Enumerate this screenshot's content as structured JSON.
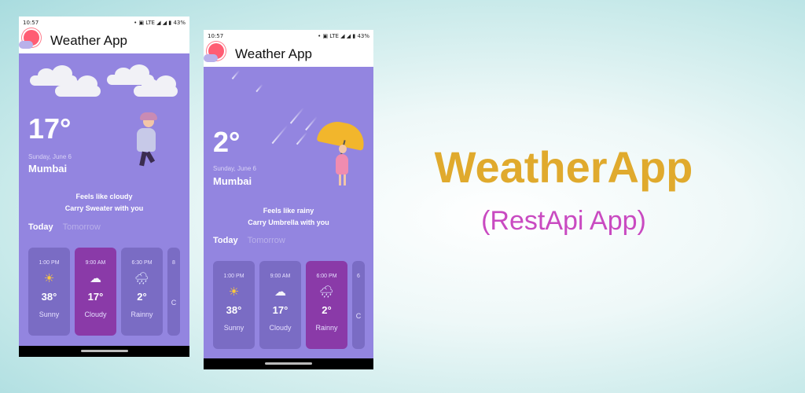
{
  "banner": {
    "title": "WeatherApp",
    "subtitle": "(RestApi App)"
  },
  "colors": {
    "title": "#e0aa2d",
    "subtitle": "#c94ac1",
    "phone_bg": "#9385e0",
    "card_bg": "#7a6cc4",
    "card_active": "#8a3aa8"
  },
  "phones": [
    {
      "status_time": "10:57",
      "status_icons": "• ▣ LTE ◢ ◢ ▮ 43%",
      "app_title": "Weather App",
      "temperature": "17°",
      "date": "Sunday, June 6",
      "city": "Mumbai",
      "feels_like": "Feels like cloudy",
      "advice": "Carry Sweater with you",
      "tabs": [
        "Today",
        "Tomorrow"
      ],
      "forecast": [
        {
          "time": "1:00 PM",
          "icon": "sun-icon",
          "glyph": "☀",
          "temp": "38°",
          "condition": "Sunny"
        },
        {
          "time": "9:00 AM",
          "icon": "cloud-icon",
          "glyph": "☁",
          "temp": "17°",
          "condition": "Cloudy"
        },
        {
          "time": "6:30 PM",
          "icon": "rain-cloud-icon",
          "glyph": "🌧",
          "temp": "2°",
          "condition": "Rainny"
        },
        {
          "time": "8",
          "icon": "",
          "glyph": "",
          "temp": "",
          "condition": "C"
        }
      ],
      "active_card": 1
    },
    {
      "status_time": "10:57",
      "status_icons": "• ▣ LTE ◢ ◢ ▮ 43%",
      "app_title": "Weather App",
      "temperature": "2°",
      "date": "Sunday, June 6",
      "city": "Mumbai",
      "feels_like": "Feels like rainy",
      "advice": "Carry Umbrella with you",
      "tabs": [
        "Today",
        "Tomorrow"
      ],
      "forecast": [
        {
          "time": "1:00 PM",
          "icon": "sun-icon",
          "glyph": "☀",
          "temp": "38°",
          "condition": "Sunny"
        },
        {
          "time": "9:00 AM",
          "icon": "cloud-icon",
          "glyph": "☁",
          "temp": "17°",
          "condition": "Cloudy"
        },
        {
          "time": "6:00 PM",
          "icon": "rain-cloud-icon",
          "glyph": "🌧",
          "temp": "2°",
          "condition": "Rainny"
        },
        {
          "time": "6",
          "icon": "",
          "glyph": "",
          "temp": "",
          "condition": "C"
        }
      ],
      "active_card": 2
    }
  ]
}
